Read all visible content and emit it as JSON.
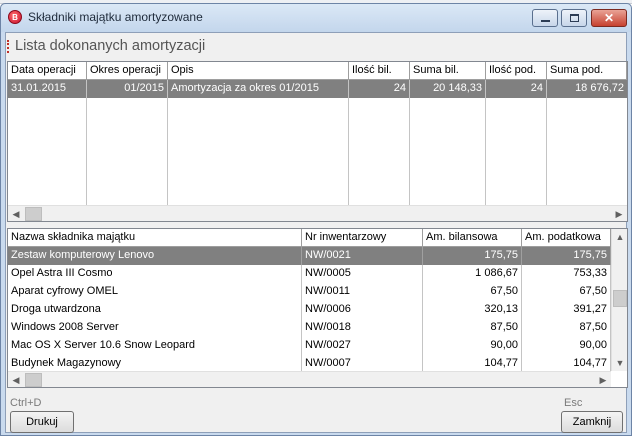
{
  "window": {
    "title": "Składniki majątku amortyzowane",
    "icon_letter": "B"
  },
  "section": {
    "title": "Lista dokonanych amortyzacji"
  },
  "top_grid": {
    "columns": [
      "Data operacji",
      "Okres operacji",
      "Opis",
      "Ilość bil.",
      "Suma bil.",
      "Ilość pod.",
      "Suma pod."
    ],
    "rows": [
      {
        "data": "31.01.2015",
        "okres": "01/2015",
        "opis": "Amortyzacja za okres 01/2015",
        "ilosc_bil": "24",
        "suma_bil": "20 148,33",
        "ilosc_pod": "24",
        "suma_pod": "18 676,72"
      }
    ]
  },
  "bottom_grid": {
    "columns": [
      "Nazwa składnika majątku",
      "Nr inwentarzowy",
      "Am. bilansowa",
      "Am. podatkowa"
    ],
    "rows": [
      {
        "nazwa": "Zestaw komputerowy Lenovo",
        "nr": "NW/0021",
        "am_bil": "175,75",
        "am_pod": "175,75"
      },
      {
        "nazwa": "Opel Astra III Cosmo",
        "nr": "NW/0005",
        "am_bil": "1 086,67",
        "am_pod": "753,33"
      },
      {
        "nazwa": "Aparat cyfrowy OMEL",
        "nr": "NW/0011",
        "am_bil": "67,50",
        "am_pod": "67,50"
      },
      {
        "nazwa": "Droga utwardzona",
        "nr": "NW/0006",
        "am_bil": "320,13",
        "am_pod": "391,27"
      },
      {
        "nazwa": "Windows 2008 Server",
        "nr": "NW/0018",
        "am_bil": "87,50",
        "am_pod": "87,50"
      },
      {
        "nazwa": "Mac OS X Server 10.6 Snow Leopard",
        "nr": "NW/0027",
        "am_bil": "90,00",
        "am_pod": "90,00"
      },
      {
        "nazwa": "Budynek Magazynowy",
        "nr": "NW/0007",
        "am_bil": "104,77",
        "am_pod": "104,77"
      }
    ]
  },
  "footer": {
    "print_shortcut": "Ctrl+D",
    "print_label": "Drukuj",
    "close_shortcut": "Esc",
    "close_label": "Zamknij"
  },
  "colors": {
    "selected_row": "#808080",
    "title_bar": "#c9daee",
    "close_button": "#c7412f",
    "section_marker": "#c0302a"
  },
  "icons": {
    "app": "bank-app-icon",
    "minimize": "minimize-icon",
    "maximize": "maximize-icon",
    "close": "close-icon",
    "scroll_left": "arrow-left-icon",
    "scroll_right": "arrow-right-icon",
    "scroll_up": "arrow-up-icon",
    "scroll_down": "arrow-down-icon"
  }
}
